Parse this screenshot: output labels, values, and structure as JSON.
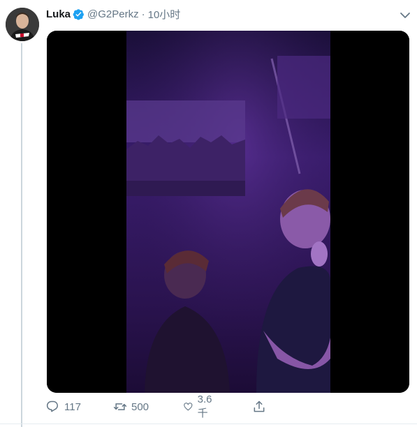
{
  "tweet": {
    "author_name": "Luka",
    "author_handle": "@G2Perkz",
    "separator": "·",
    "time": "10小时",
    "verified": true
  },
  "icons": {
    "verified": "verified-badge-icon",
    "more": "chevron-down-icon",
    "reply": "reply-icon",
    "retweet": "retweet-icon",
    "like": "like-heart-icon",
    "share": "share-icon"
  },
  "actions": {
    "reply_count": "117",
    "retweet_count": "500",
    "like_count": "3.6千"
  },
  "colors": {
    "verified_blue": "#1da1f2",
    "muted_text": "#657786",
    "video_purple": "#3c1d78"
  }
}
